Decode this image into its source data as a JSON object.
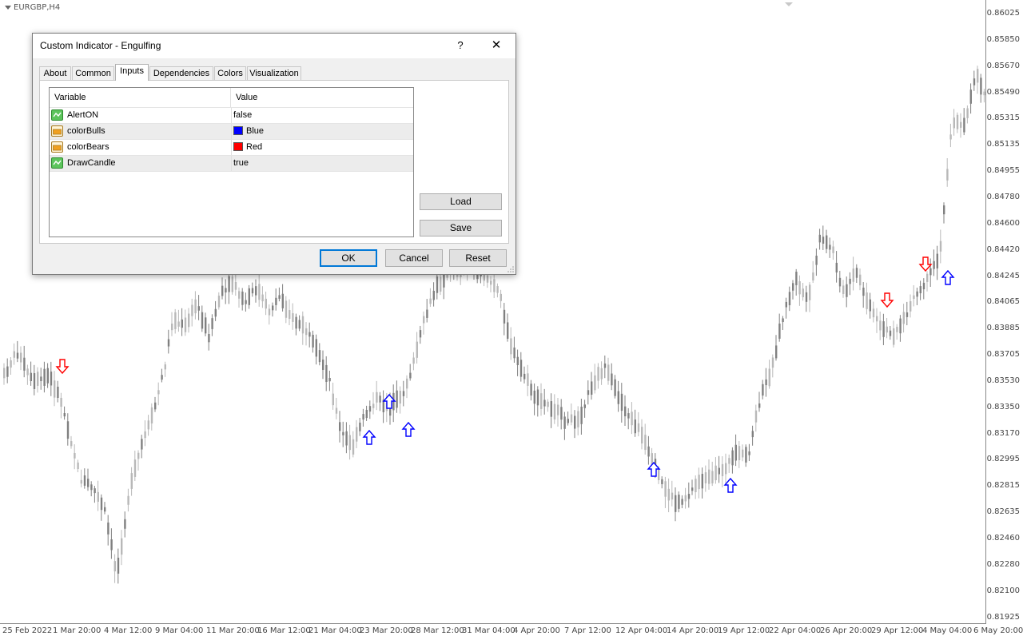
{
  "chart": {
    "symbol": "EURGBP,H4",
    "price_labels": [
      "0.86025",
      "0.85850",
      "0.85670",
      "0.85490",
      "0.85315",
      "0.85135",
      "0.84955",
      "0.84780",
      "0.84600",
      "0.84420",
      "0.84245",
      "0.84065",
      "0.83885",
      "0.83705",
      "0.83530",
      "0.83350",
      "0.83170",
      "0.82995",
      "0.82815",
      "0.82635",
      "0.82460",
      "0.82280",
      "0.82100",
      "0.81925"
    ],
    "time_labels": [
      "25 Feb 2022",
      "1 Mar 20:00",
      "4 Mar 12:00",
      "9 Mar 04:00",
      "11 Mar 20:00",
      "16 Mar 12:00",
      "21 Mar 04:00",
      "23 Mar 20:00",
      "28 Mar 12:00",
      "31 Mar 04:00",
      "4 Apr 20:00",
      "7 Apr 12:00",
      "12 Apr 04:00",
      "14 Apr 20:00",
      "19 Apr 12:00",
      "22 Apr 04:00",
      "26 Apr 20:00",
      "29 Apr 12:00",
      "4 May 04:00",
      "6 May 20:00"
    ],
    "colors": {
      "candle": "#808080",
      "candle_light": "#b8b8b8",
      "bull_arrow": "#0000ff",
      "bear_arrow": "#ff0000"
    }
  },
  "dialog": {
    "title": "Custom Indicator - Engulfing",
    "help_label": "?",
    "close_label": "✕",
    "tabs": [
      {
        "label": "About"
      },
      {
        "label": "Common"
      },
      {
        "label": "Inputs",
        "active": true
      },
      {
        "label": "Dependencies"
      },
      {
        "label": "Colors"
      },
      {
        "label": "Visualization"
      }
    ],
    "grid": {
      "headers": {
        "variable": "Variable",
        "value": "Value"
      },
      "rows": [
        {
          "name": "AlertON",
          "value": "false",
          "icon": "bool-param-icon"
        },
        {
          "name": "colorBulls",
          "value": "Blue",
          "icon": "color-param-icon",
          "swatch": "#0000ff"
        },
        {
          "name": "colorBears",
          "value": "Red",
          "icon": "color-param-icon",
          "swatch": "#ff0000"
        },
        {
          "name": "DrawCandle",
          "value": "true",
          "icon": "bool-param-icon"
        }
      ]
    },
    "load_label": "Load",
    "save_label": "Save",
    "ok_label": "OK",
    "cancel_label": "Cancel",
    "reset_label": "Reset"
  }
}
